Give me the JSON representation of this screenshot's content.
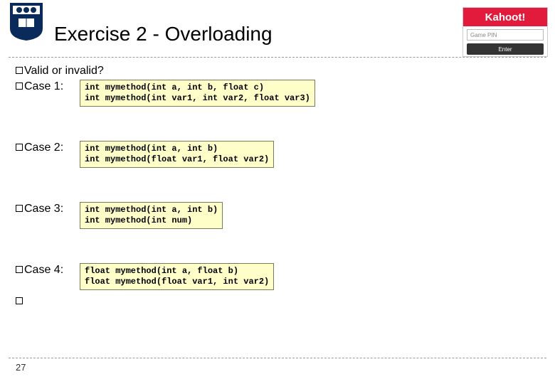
{
  "title": "Exercise 2 - Overloading",
  "question": "Valid or invalid?",
  "cases": [
    {
      "label": "Case 1:",
      "code": "int mymethod(int a, int b, float c)\nint mymethod(int var1, int var2, float var3)"
    },
    {
      "label": "Case 2:",
      "code": "int mymethod(int a, int b)\nint mymethod(float var1, float var2)"
    },
    {
      "label": "Case 3:",
      "code": "int mymethod(int a, int b)\nint mymethod(int num)"
    },
    {
      "label": "Case 4:",
      "code": "float mymethod(int a, float b)\nfloat mymethod(float var1, int var2)"
    }
  ],
  "page_number": "27",
  "kahoot": {
    "brand": "Kahoot!",
    "pin_placeholder": "Game PIN",
    "enter_label": "Enter"
  }
}
